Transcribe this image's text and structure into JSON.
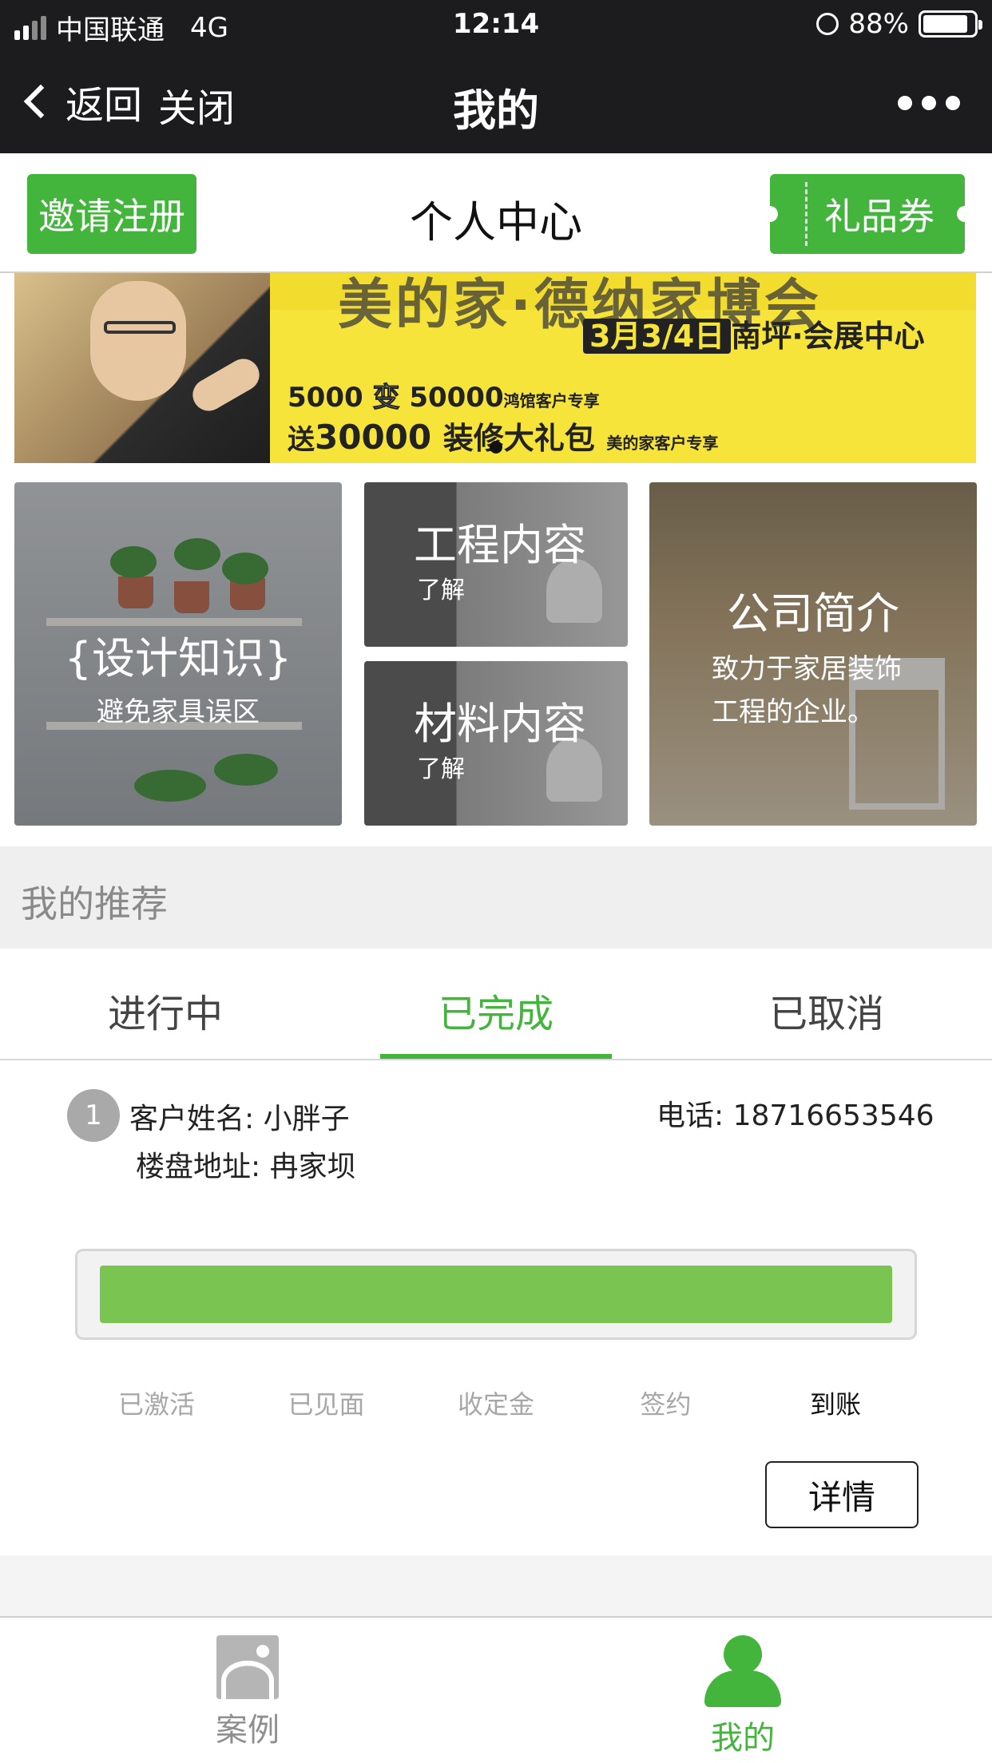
{
  "status_bar": {
    "carrier": "中国联通",
    "network": "4G",
    "time": "12:14",
    "battery": "88%",
    "battery_level": 0.88
  },
  "nav": {
    "back_label": "返回",
    "close_label": "关闭",
    "title": "我的"
  },
  "header": {
    "invite_label": "邀请注册",
    "title": "个人中心",
    "gift_label": "礼品券"
  },
  "banner": {
    "headline": "美的家·德纳家博会",
    "date_place": "3月3/4日",
    "venue": "南坪·会展中心",
    "offer1_prefix": "5000",
    "offer1_mid": "变",
    "offer1_suffix": "50000",
    "offer1_note": "鸿馆客户专享",
    "offer2_prefix": "送",
    "offer2_price": "30000",
    "offer2_text": "装修大礼包",
    "offer2_note": "美的家客户专享"
  },
  "tiles": {
    "design": {
      "title": "{设计知识}",
      "subtitle": "避免家具误区"
    },
    "engineering": {
      "title": "工程内容",
      "subtitle": "了解"
    },
    "materials": {
      "title": "材料内容",
      "subtitle": "了解"
    },
    "about": {
      "title": "公司简介",
      "line1": "致力于家居装饰",
      "line2": "工程的企业。"
    }
  },
  "section": {
    "title": "我的推荐"
  },
  "tabs": [
    {
      "label": "进行中"
    },
    {
      "label": "已完成"
    },
    {
      "label": "已取消"
    }
  ],
  "record": {
    "index": "1",
    "customer_label": "客户姓名:",
    "customer_name": "小胖子",
    "phone_label": "电话:",
    "phone": "18716653546",
    "address_label": "楼盘地址:",
    "address": "冉家坝",
    "progress": 1.0,
    "steps": [
      "已激活",
      "已见面",
      "收定金",
      "签约",
      "到账"
    ],
    "detail_label": "详情"
  },
  "tabbar": {
    "cases_label": "案例",
    "mine_label": "我的"
  },
  "colors": {
    "accent_green": "#44b53c",
    "progress_green": "#7ac451",
    "nav_dark": "#1c1c1e",
    "banner_yellow": "#f6e43a"
  },
  "icons": [
    "back-chevron-icon",
    "more-dots-icon",
    "signal-icon",
    "alarm-icon",
    "battery-icon",
    "image-icon",
    "user-icon"
  ]
}
